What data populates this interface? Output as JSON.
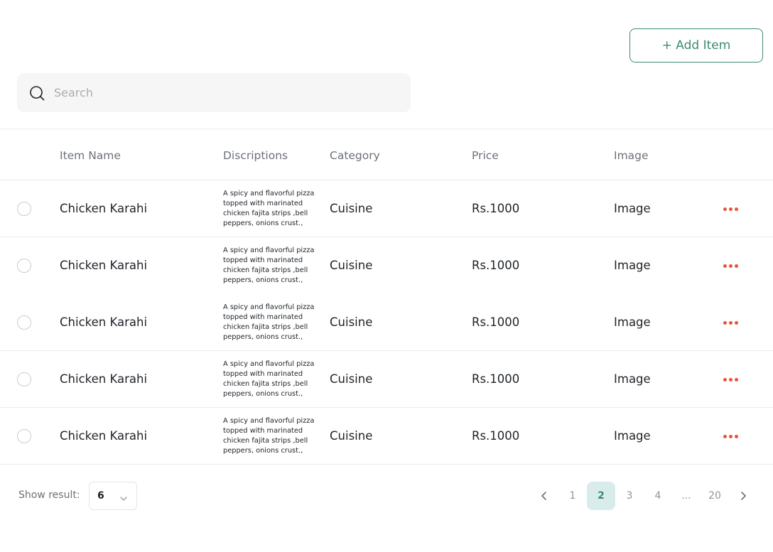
{
  "toolbar": {
    "add_label": "+ Add Item"
  },
  "search": {
    "placeholder": "Search",
    "value": ""
  },
  "table": {
    "headers": [
      "Item Name",
      "Discriptions",
      "Category",
      "Price",
      "Image"
    ],
    "rows": [
      {
        "name": "Chicken Karahi",
        "description": "A spicy and flavorful pizza topped with marinated chicken fajita strips ,bell peppers, onions crust.,",
        "category": "Cuisine",
        "price": "Rs.1000",
        "image": "Image"
      },
      {
        "name": "Chicken Karahi",
        "description": "A spicy and flavorful pizza topped with marinated chicken fajita strips ,bell peppers, onions crust.,",
        "category": "Cuisine",
        "price": "Rs.1000",
        "image": "Image"
      },
      {
        "name": "Chicken Karahi",
        "description": "A spicy and flavorful pizza topped with marinated chicken fajita strips ,bell peppers, onions crust.,",
        "category": "Cuisine",
        "price": "Rs.1000",
        "image": "Image"
      },
      {
        "name": "Chicken Karahi",
        "description": "A spicy and flavorful pizza topped with marinated chicken fajita strips ,bell peppers, onions crust.,",
        "category": "Cuisine",
        "price": "Rs.1000",
        "image": "Image"
      },
      {
        "name": "Chicken Karahi",
        "description": "A spicy and flavorful pizza topped with marinated chicken fajita strips ,bell peppers, onions crust.,",
        "category": "Cuisine",
        "price": "Rs.1000",
        "image": "Image"
      }
    ]
  },
  "footer": {
    "show_label": "Show result:",
    "page_size": "6",
    "pages": [
      "1",
      "2",
      "3",
      "4",
      "...",
      "20"
    ],
    "active_page": "2"
  },
  "icons": {
    "search": "search-icon",
    "more": "more-horizontal-icon",
    "prev": "chevron-left-icon",
    "next": "chevron-right-icon",
    "dropdown": "chevron-down-icon"
  },
  "colors": {
    "accent": "#3f8a73",
    "action_dots": "#e8533a",
    "active_page_bg": "#d9ecec"
  }
}
